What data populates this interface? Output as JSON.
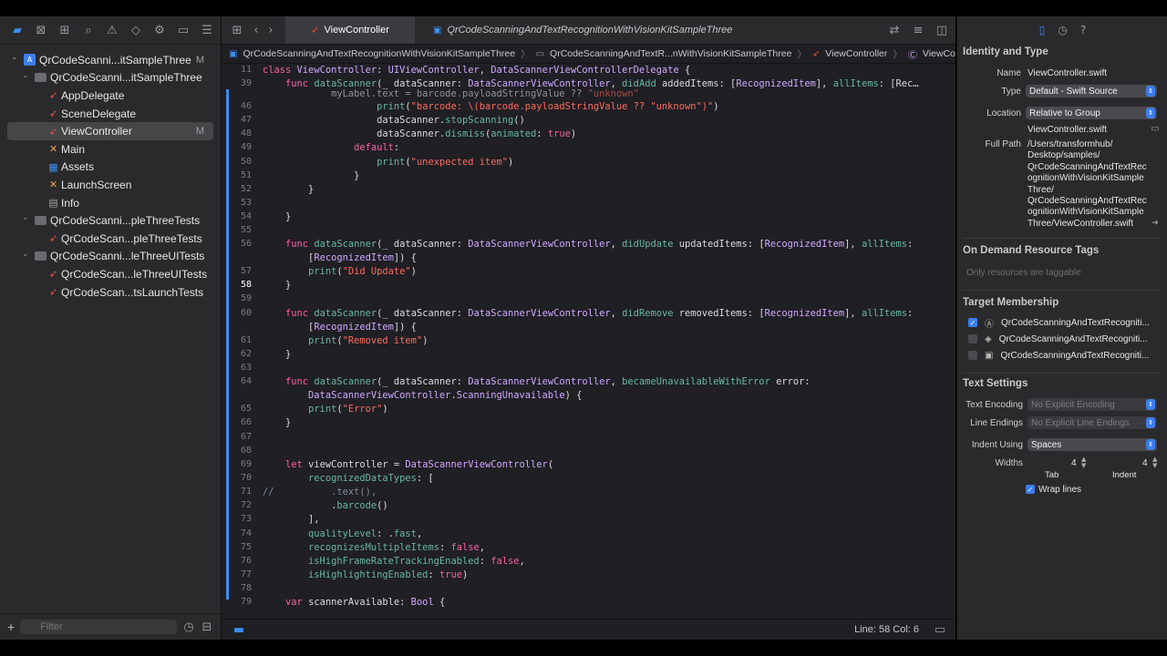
{
  "navigator": {
    "tree": [
      {
        "label": "QrCodeScanni...itSampleThree",
        "icon": "project",
        "badge": "M",
        "level": 0
      },
      {
        "label": "QrCodeScanni...itSampleThree",
        "icon": "folder",
        "badge": "",
        "level": 1
      },
      {
        "label": "AppDelegate",
        "icon": "swift",
        "badge": "",
        "level": 2
      },
      {
        "label": "SceneDelegate",
        "icon": "swift",
        "badge": "",
        "level": 2
      },
      {
        "label": "ViewController",
        "icon": "swift",
        "badge": "M",
        "level": 2,
        "selected": true
      },
      {
        "label": "Main",
        "icon": "xib",
        "badge": "",
        "level": 2
      },
      {
        "label": "Assets",
        "icon": "assets",
        "badge": "",
        "level": 2
      },
      {
        "label": "LaunchScreen",
        "icon": "xib",
        "badge": "",
        "level": 2
      },
      {
        "label": "Info",
        "icon": "plist",
        "badge": "",
        "level": 2
      },
      {
        "label": "QrCodeScanni...pleThreeTests",
        "icon": "folder",
        "badge": "",
        "level": 1
      },
      {
        "label": "QrCodeScan...pleThreeTests",
        "icon": "swift",
        "badge": "",
        "level": 2
      },
      {
        "label": "QrCodeScanni...leThreeUITests",
        "icon": "folder",
        "badge": "",
        "level": 1
      },
      {
        "label": "QrCodeScan...leThreeUITests",
        "icon": "swift",
        "badge": "",
        "level": 2
      },
      {
        "label": "QrCodeScan...tsLaunchTests",
        "icon": "swift",
        "badge": "",
        "level": 2
      }
    ],
    "filter_placeholder": "Filter"
  },
  "editor": {
    "tabs": [
      {
        "label": "ViewController",
        "active": true
      },
      {
        "label": "QrCodeScanningAndTextRecognitionWithVisionKitSampleThree",
        "active": false
      }
    ],
    "breadcrumb": [
      "QrCodeScanningAndTextRecognitionWithVisionKitSampleThree",
      "QrCodeScanningAndTextR...nWithVisionKitSampleThree",
      "ViewController",
      "ViewController"
    ],
    "status": "Line: 58  Col: 6"
  },
  "inspector": {
    "identity_title": "Identity and Type",
    "name_label": "Name",
    "name_value": "ViewController.swift",
    "type_label": "Type",
    "type_value": "Default - Swift Source",
    "location_label": "Location",
    "location_value": "Relative to Group",
    "location_file": "ViewController.swift",
    "fullpath_label": "Full Path",
    "fullpath_value": "/Users/transformhub/\nDesktop/samples/\nQrCodeScanningAndTextRec\nognitionWithVisionKitSample\nThree/\nQrCodeScanningAndTextRec\nognitionWithVisionKitSample\nThree/ViewController.swift",
    "odr_title": "On Demand Resource Tags",
    "odr_placeholder": "Only resources are taggable",
    "membership_title": "Target Membership",
    "members": [
      {
        "label": "QrCodeScanningAndTextRecogniti...",
        "checked": true
      },
      {
        "label": "QrCodeScanningAndTextRecogniti...",
        "checked": false
      },
      {
        "label": "QrCodeScanningAndTextRecogniti...",
        "checked": false
      }
    ],
    "text_title": "Text Settings",
    "encoding_label": "Text Encoding",
    "encoding_value": "No Explicit Encoding",
    "endings_label": "Line Endings",
    "endings_value": "No Explicit Line Endings",
    "indent_label": "Indent Using",
    "indent_value": "Spaces",
    "widths_label": "Widths",
    "tab_width": "4",
    "indent_width": "4",
    "tab_label": "Tab",
    "indent_sub_label": "Indent",
    "wrap_label": "Wrap lines"
  },
  "colors": {
    "accent": "#3d8ef0",
    "keyword": "#fc5fa3",
    "string": "#fc6a5d",
    "type": "#d0a8ff"
  }
}
